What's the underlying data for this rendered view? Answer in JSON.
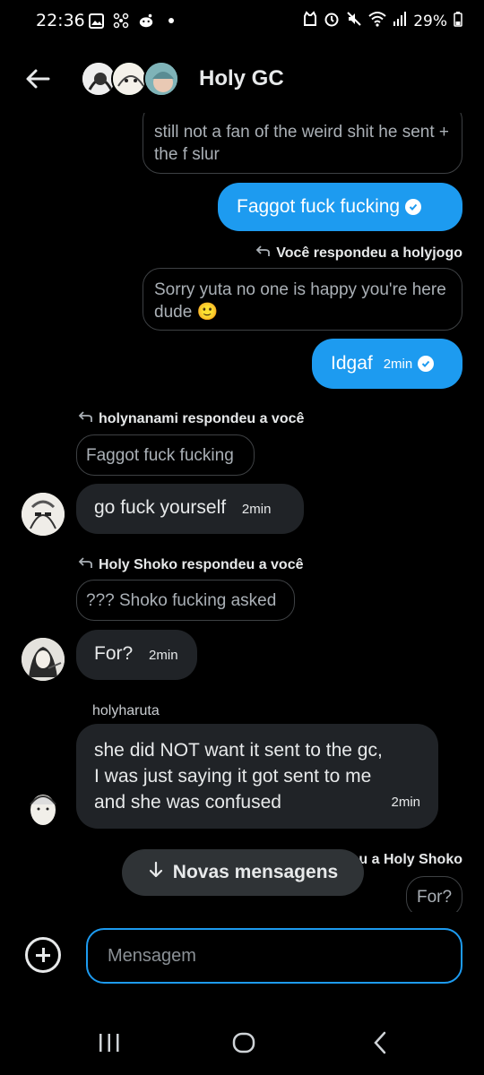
{
  "status_bar": {
    "time": "22:36",
    "battery": "29%",
    "icons": [
      "gallery-icon",
      "pinwheel-icon",
      "reddit-icon",
      "dot-icon",
      "cat-icon",
      "alarm-icon",
      "mute-icon",
      "wifi-icon",
      "signal-icon",
      "battery-icon"
    ]
  },
  "header": {
    "title": "Holy GC"
  },
  "messages": {
    "m1_text": "still not a fan of the weird shit he sent + the f slur",
    "m2_text": "Faggot fuck fucking",
    "m3_reply_label": "Você respondeu a holyjogo",
    "m3_quote": "Sorry yuta no one is happy you're here dude 🙂",
    "m3_text": "Idgaf",
    "m3_time": "2min",
    "m4_reply_label": "holynanami respondeu a você",
    "m4_quote": "Faggot fuck fucking",
    "m4_text": "go fuck yourself",
    "m4_time": "2min",
    "m5_reply_label": "Holy Shoko respondeu a você",
    "m5_quote": "??? Shoko fucking asked",
    "m5_text": "For?",
    "m5_time": "2min",
    "m6_sender": "holyharuta",
    "m6_text_line1": "she did NOT want it sent to the gc,",
    "m6_text_line2": "I was just saying it got sent to me",
    "m6_text_line3": "and she was confused",
    "m6_time": "2min",
    "m7_reply_label_partial": "u a Holy Shoko",
    "m7_quote": "For?"
  },
  "new_messages_pill": "Novas mensagens",
  "composer": {
    "placeholder": "Mensagem"
  },
  "colors": {
    "accent": "#1d9bf0",
    "incoming_bubble": "#202327",
    "background": "#000000"
  }
}
